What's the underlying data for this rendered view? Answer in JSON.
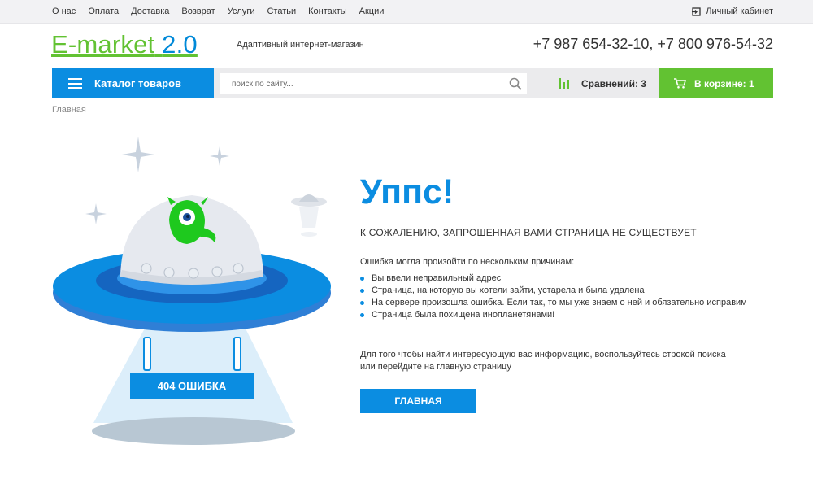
{
  "topnav": {
    "links": [
      "О нас",
      "Оплата",
      "Доставка",
      "Возврат",
      "Услуги",
      "Статьи",
      "Контакты",
      "Акции"
    ],
    "cabinet_label": "Личный кабинет"
  },
  "header": {
    "logo_main": "E-market",
    "logo_version": "2.0",
    "tagline": "Адаптивный интернет-магазин",
    "phones": "+7 987 654-32-10, +7 800 976-54-32"
  },
  "navbar": {
    "catalog_label": "Каталог товаров",
    "search_placeholder": "поиск по сайту...",
    "compare_label": "Сравнений: 3",
    "cart_label": "В корзине: 1"
  },
  "breadcrumb": "Главная",
  "error": {
    "title": "Уппс!",
    "subtitle": "К сожалению, запрошенная вами страница не существует",
    "intro": "Ошибка могла произойти по нескольким причинам:",
    "reasons": [
      "Вы ввели неправильный адрес",
      "Страница, на которую вы хотели зайти, устарела и была удалена",
      "На сервере произошла ошибка. Если так, то мы уже знаем о ней и обязательно исправим",
      "Страница была похищена инопланетянами!"
    ],
    "hint": "Для того чтобы найти интересующую вас информацию, воспользуйтесь строкой поиска или перейдите на главную страницу",
    "home_button": "Главная",
    "badge": "404 ошибка"
  },
  "colors": {
    "accent_blue": "#0b8de1",
    "accent_green": "#62c232"
  }
}
